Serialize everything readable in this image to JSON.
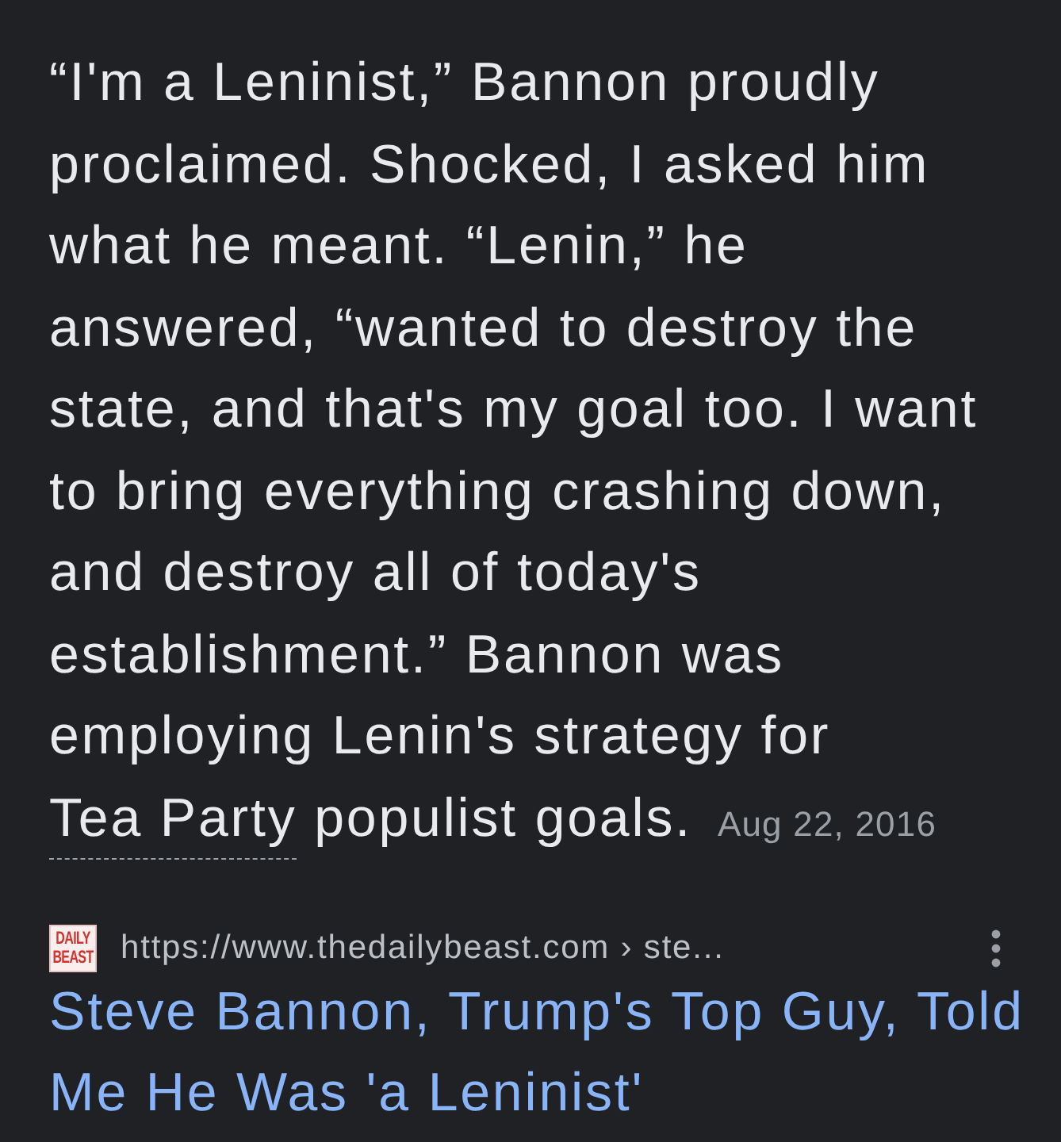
{
  "snippet": {
    "segments": [
      {
        "kind": "text",
        "text": "“I'm a Leninist,” Bannon proudly proclaimed. Shocked, I asked him what he meant. “Lenin,” he answered, “wanted to destroy the state, and that's my goal too. I want to bring everything crashing down, and destroy all of today's establishment.” Bannon was employing Lenin's strategy for "
      },
      {
        "kind": "link",
        "text": "Tea Party"
      },
      {
        "kind": "text",
        "text": " populist goals."
      }
    ],
    "date": "Aug 22, 2016"
  },
  "result": {
    "favicon_text": [
      "DAILY",
      "BEAST"
    ],
    "url": "https://www.thedailybeast.com › ste...",
    "title": "Steve Bannon, Trump's Top Guy, Told Me He Was 'a Leninist'"
  }
}
